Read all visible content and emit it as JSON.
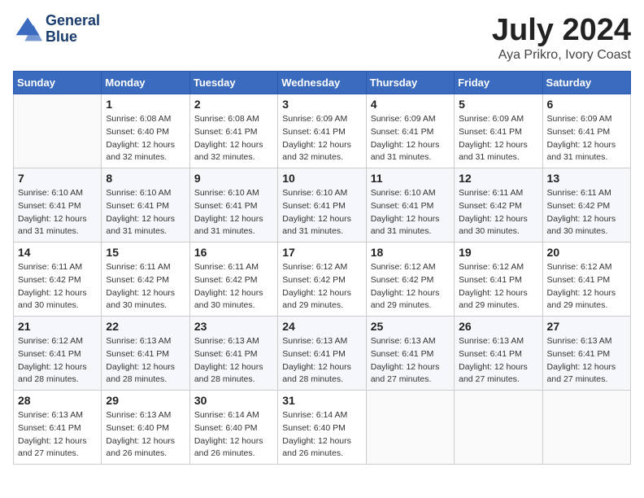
{
  "header": {
    "logo_line1": "General",
    "logo_line2": "Blue",
    "title": "July 2024",
    "subtitle": "Aya Prikro, Ivory Coast"
  },
  "weekdays": [
    "Sunday",
    "Monday",
    "Tuesday",
    "Wednesday",
    "Thursday",
    "Friday",
    "Saturday"
  ],
  "weeks": [
    [
      {
        "day": "",
        "empty": true
      },
      {
        "day": "1",
        "sunrise": "6:08 AM",
        "sunset": "6:40 PM",
        "daylight": "12 hours and 32 minutes."
      },
      {
        "day": "2",
        "sunrise": "6:08 AM",
        "sunset": "6:41 PM",
        "daylight": "12 hours and 32 minutes."
      },
      {
        "day": "3",
        "sunrise": "6:09 AM",
        "sunset": "6:41 PM",
        "daylight": "12 hours and 32 minutes."
      },
      {
        "day": "4",
        "sunrise": "6:09 AM",
        "sunset": "6:41 PM",
        "daylight": "12 hours and 31 minutes."
      },
      {
        "day": "5",
        "sunrise": "6:09 AM",
        "sunset": "6:41 PM",
        "daylight": "12 hours and 31 minutes."
      },
      {
        "day": "6",
        "sunrise": "6:09 AM",
        "sunset": "6:41 PM",
        "daylight": "12 hours and 31 minutes."
      }
    ],
    [
      {
        "day": "7",
        "sunrise": "6:10 AM",
        "sunset": "6:41 PM",
        "daylight": "12 hours and 31 minutes."
      },
      {
        "day": "8",
        "sunrise": "6:10 AM",
        "sunset": "6:41 PM",
        "daylight": "12 hours and 31 minutes."
      },
      {
        "day": "9",
        "sunrise": "6:10 AM",
        "sunset": "6:41 PM",
        "daylight": "12 hours and 31 minutes."
      },
      {
        "day": "10",
        "sunrise": "6:10 AM",
        "sunset": "6:41 PM",
        "daylight": "12 hours and 31 minutes."
      },
      {
        "day": "11",
        "sunrise": "6:10 AM",
        "sunset": "6:41 PM",
        "daylight": "12 hours and 31 minutes."
      },
      {
        "day": "12",
        "sunrise": "6:11 AM",
        "sunset": "6:42 PM",
        "daylight": "12 hours and 30 minutes."
      },
      {
        "day": "13",
        "sunrise": "6:11 AM",
        "sunset": "6:42 PM",
        "daylight": "12 hours and 30 minutes."
      }
    ],
    [
      {
        "day": "14",
        "sunrise": "6:11 AM",
        "sunset": "6:42 PM",
        "daylight": "12 hours and 30 minutes."
      },
      {
        "day": "15",
        "sunrise": "6:11 AM",
        "sunset": "6:42 PM",
        "daylight": "12 hours and 30 minutes."
      },
      {
        "day": "16",
        "sunrise": "6:11 AM",
        "sunset": "6:42 PM",
        "daylight": "12 hours and 30 minutes."
      },
      {
        "day": "17",
        "sunrise": "6:12 AM",
        "sunset": "6:42 PM",
        "daylight": "12 hours and 29 minutes."
      },
      {
        "day": "18",
        "sunrise": "6:12 AM",
        "sunset": "6:42 PM",
        "daylight": "12 hours and 29 minutes."
      },
      {
        "day": "19",
        "sunrise": "6:12 AM",
        "sunset": "6:41 PM",
        "daylight": "12 hours and 29 minutes."
      },
      {
        "day": "20",
        "sunrise": "6:12 AM",
        "sunset": "6:41 PM",
        "daylight": "12 hours and 29 minutes."
      }
    ],
    [
      {
        "day": "21",
        "sunrise": "6:12 AM",
        "sunset": "6:41 PM",
        "daylight": "12 hours and 28 minutes."
      },
      {
        "day": "22",
        "sunrise": "6:13 AM",
        "sunset": "6:41 PM",
        "daylight": "12 hours and 28 minutes."
      },
      {
        "day": "23",
        "sunrise": "6:13 AM",
        "sunset": "6:41 PM",
        "daylight": "12 hours and 28 minutes."
      },
      {
        "day": "24",
        "sunrise": "6:13 AM",
        "sunset": "6:41 PM",
        "daylight": "12 hours and 28 minutes."
      },
      {
        "day": "25",
        "sunrise": "6:13 AM",
        "sunset": "6:41 PM",
        "daylight": "12 hours and 27 minutes."
      },
      {
        "day": "26",
        "sunrise": "6:13 AM",
        "sunset": "6:41 PM",
        "daylight": "12 hours and 27 minutes."
      },
      {
        "day": "27",
        "sunrise": "6:13 AM",
        "sunset": "6:41 PM",
        "daylight": "12 hours and 27 minutes."
      }
    ],
    [
      {
        "day": "28",
        "sunrise": "6:13 AM",
        "sunset": "6:41 PM",
        "daylight": "12 hours and 27 minutes."
      },
      {
        "day": "29",
        "sunrise": "6:13 AM",
        "sunset": "6:40 PM",
        "daylight": "12 hours and 26 minutes."
      },
      {
        "day": "30",
        "sunrise": "6:14 AM",
        "sunset": "6:40 PM",
        "daylight": "12 hours and 26 minutes."
      },
      {
        "day": "31",
        "sunrise": "6:14 AM",
        "sunset": "6:40 PM",
        "daylight": "12 hours and 26 minutes."
      },
      {
        "day": "",
        "empty": true
      },
      {
        "day": "",
        "empty": true
      },
      {
        "day": "",
        "empty": true
      }
    ]
  ],
  "labels": {
    "sunrise": "Sunrise:",
    "sunset": "Sunset:",
    "daylight": "Daylight:"
  }
}
